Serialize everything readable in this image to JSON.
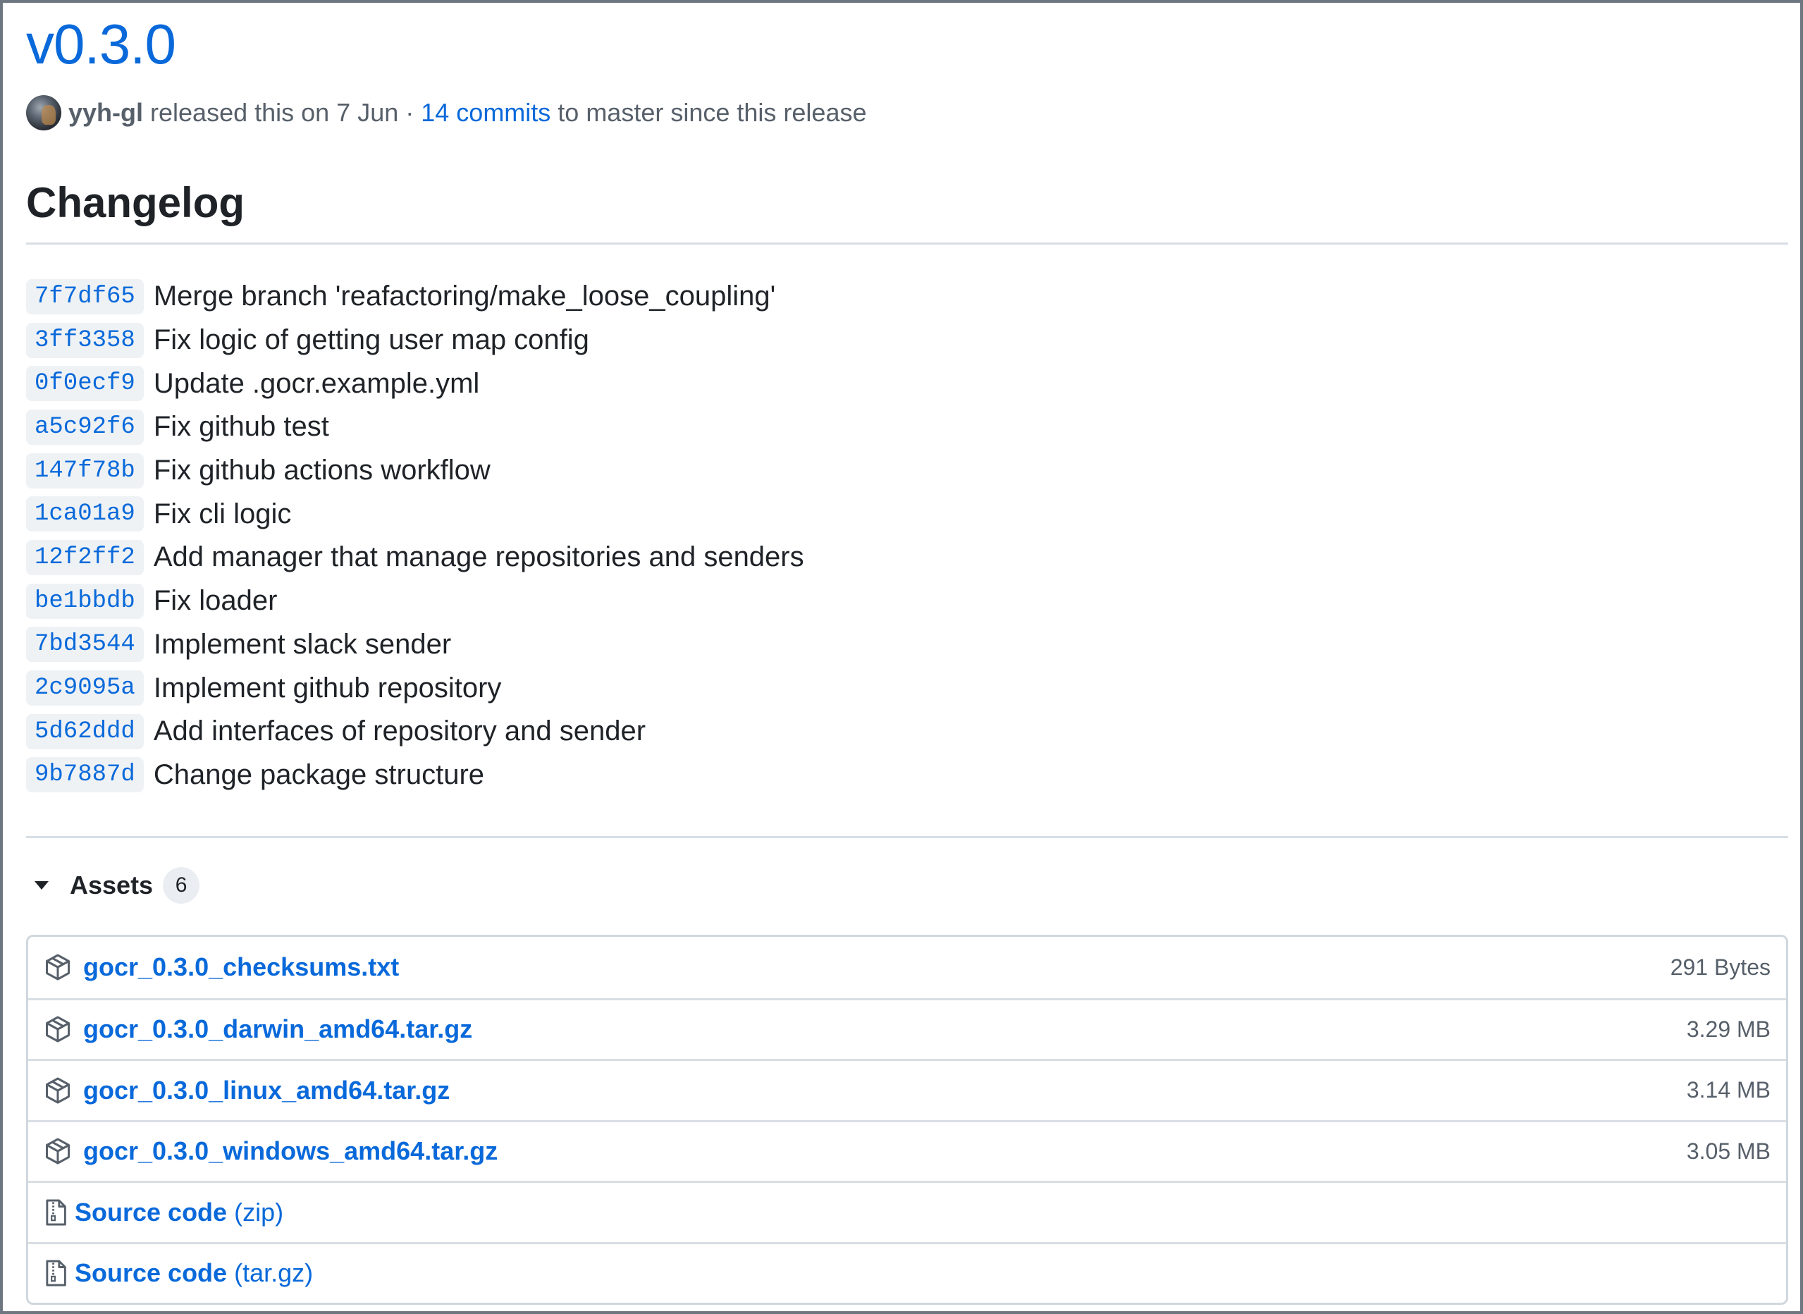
{
  "release": {
    "title": "v0.3.0",
    "author": "yyh-gl",
    "released_text": "released this on 7 Jun",
    "separator": "·",
    "commits_link": "14 commits",
    "since_text": "to master since this release"
  },
  "changelog": {
    "heading": "Changelog",
    "commits": [
      {
        "sha": "7f7df65",
        "message": "Merge branch 'reafactoring/make_loose_coupling'"
      },
      {
        "sha": "3ff3358",
        "message": "Fix logic of getting user map config"
      },
      {
        "sha": "0f0ecf9",
        "message": "Update .gocr.example.yml"
      },
      {
        "sha": "a5c92f6",
        "message": "Fix github test"
      },
      {
        "sha": "147f78b",
        "message": "Fix github actions workflow"
      },
      {
        "sha": "1ca01a9",
        "message": "Fix cli logic"
      },
      {
        "sha": "12f2ff2",
        "message": "Add manager that manage repositories and senders"
      },
      {
        "sha": "be1bbdb",
        "message": "Fix loader"
      },
      {
        "sha": "7bd3544",
        "message": "Implement slack sender"
      },
      {
        "sha": "2c9095a",
        "message": "Implement github repository"
      },
      {
        "sha": "5d62ddd",
        "message": "Add interfaces of repository and sender"
      },
      {
        "sha": "9b7887d",
        "message": "Change package structure"
      }
    ]
  },
  "assets": {
    "label": "Assets",
    "count": "6",
    "files": [
      {
        "name": "gocr_0.3.0_checksums.txt",
        "size": "291 Bytes",
        "icon": "package-icon"
      },
      {
        "name": "gocr_0.3.0_darwin_amd64.tar.gz",
        "size": "3.29 MB",
        "icon": "package-icon"
      },
      {
        "name": "gocr_0.3.0_linux_amd64.tar.gz",
        "size": "3.14 MB",
        "icon": "package-icon"
      },
      {
        "name": "gocr_0.3.0_windows_amd64.tar.gz",
        "size": "3.05 MB",
        "icon": "package-icon"
      },
      {
        "name": "Source code",
        "suffix": "(zip)",
        "icon": "file-zip-icon"
      },
      {
        "name": "Source code",
        "suffix": "(tar.gz)",
        "icon": "file-zip-icon"
      }
    ]
  },
  "colors": {
    "link": "#0969da",
    "text": "#1f2328",
    "muted": "#57606a",
    "border": "#d0d7de"
  }
}
